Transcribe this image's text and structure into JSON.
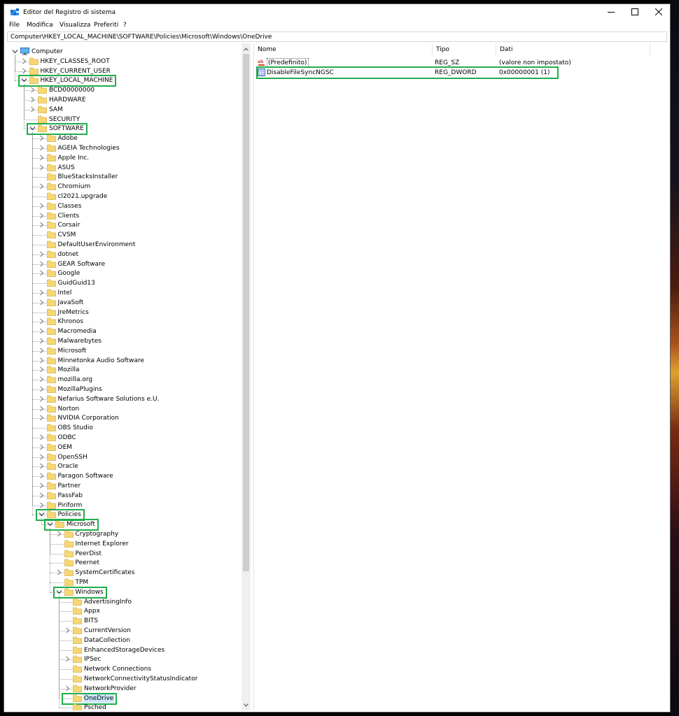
{
  "window": {
    "title": "Editor del Registro di sistema",
    "controls": [
      "minimize",
      "maximize",
      "close"
    ]
  },
  "menu": [
    "File",
    "Modifica",
    "Visualizza",
    "Preferiti",
    "?"
  ],
  "address": "Computer\\HKEY_LOCAL_MACHINE\\SOFTWARE\\Policies\\Microsoft\\Windows\\OneDrive",
  "tree": [
    {
      "label": "Computer",
      "depth": 0,
      "exp": "open",
      "icon": "computer"
    },
    {
      "label": "HKEY_CLASSES_ROOT",
      "depth": 1,
      "exp": "closed"
    },
    {
      "label": "HKEY_CURRENT_USER",
      "depth": 1,
      "exp": "closed"
    },
    {
      "label": "HKEY_LOCAL_MACHINE",
      "depth": 1,
      "exp": "open",
      "highlight": true
    },
    {
      "label": "BCD00000000",
      "depth": 2,
      "exp": "closed"
    },
    {
      "label": "HARDWARE",
      "depth": 2,
      "exp": "closed"
    },
    {
      "label": "SAM",
      "depth": 2,
      "exp": "closed"
    },
    {
      "label": "SECURITY",
      "depth": 2,
      "exp": "none"
    },
    {
      "label": "SOFTWARE",
      "depth": 2,
      "exp": "open",
      "highlight": true
    },
    {
      "label": "Adobe",
      "depth": 3,
      "exp": "closed"
    },
    {
      "label": "AGEIA Technologies",
      "depth": 3,
      "exp": "closed"
    },
    {
      "label": "Apple Inc.",
      "depth": 3,
      "exp": "closed"
    },
    {
      "label": "ASUS",
      "depth": 3,
      "exp": "closed"
    },
    {
      "label": "BlueStacksInstaller",
      "depth": 3,
      "exp": "none"
    },
    {
      "label": "Chromium",
      "depth": 3,
      "exp": "closed"
    },
    {
      "label": "cl2021.upgrade",
      "depth": 3,
      "exp": "none"
    },
    {
      "label": "Classes",
      "depth": 3,
      "exp": "closed"
    },
    {
      "label": "Clients",
      "depth": 3,
      "exp": "closed"
    },
    {
      "label": "Corsair",
      "depth": 3,
      "exp": "closed"
    },
    {
      "label": "CVSM",
      "depth": 3,
      "exp": "none"
    },
    {
      "label": "DefaultUserEnvironment",
      "depth": 3,
      "exp": "none"
    },
    {
      "label": "dotnet",
      "depth": 3,
      "exp": "closed"
    },
    {
      "label": "GEAR Software",
      "depth": 3,
      "exp": "closed"
    },
    {
      "label": "Google",
      "depth": 3,
      "exp": "closed"
    },
    {
      "label": "GuidGuid13",
      "depth": 3,
      "exp": "none"
    },
    {
      "label": "Intel",
      "depth": 3,
      "exp": "closed"
    },
    {
      "label": "JavaSoft",
      "depth": 3,
      "exp": "closed"
    },
    {
      "label": "JreMetrics",
      "depth": 3,
      "exp": "none"
    },
    {
      "label": "Khronos",
      "depth": 3,
      "exp": "closed"
    },
    {
      "label": "Macromedia",
      "depth": 3,
      "exp": "closed"
    },
    {
      "label": "Malwarebytes",
      "depth": 3,
      "exp": "closed"
    },
    {
      "label": "Microsoft",
      "depth": 3,
      "exp": "closed"
    },
    {
      "label": "Minnetonka Audio Software",
      "depth": 3,
      "exp": "closed"
    },
    {
      "label": "Mozilla",
      "depth": 3,
      "exp": "closed"
    },
    {
      "label": "mozilla.org",
      "depth": 3,
      "exp": "closed"
    },
    {
      "label": "MozillaPlugins",
      "depth": 3,
      "exp": "closed"
    },
    {
      "label": "Nefarius Software Solutions e.U.",
      "depth": 3,
      "exp": "closed"
    },
    {
      "label": "Norton",
      "depth": 3,
      "exp": "closed"
    },
    {
      "label": "NVIDIA Corporation",
      "depth": 3,
      "exp": "closed"
    },
    {
      "label": "OBS Studio",
      "depth": 3,
      "exp": "none"
    },
    {
      "label": "ODBC",
      "depth": 3,
      "exp": "closed"
    },
    {
      "label": "OEM",
      "depth": 3,
      "exp": "closed"
    },
    {
      "label": "OpenSSH",
      "depth": 3,
      "exp": "closed"
    },
    {
      "label": "Oracle",
      "depth": 3,
      "exp": "closed"
    },
    {
      "label": "Paragon Software",
      "depth": 3,
      "exp": "closed"
    },
    {
      "label": "Partner",
      "depth": 3,
      "exp": "closed"
    },
    {
      "label": "PassFab",
      "depth": 3,
      "exp": "closed"
    },
    {
      "label": "Piriform",
      "depth": 3,
      "exp": "closed"
    },
    {
      "label": "Policies",
      "depth": 3,
      "exp": "open",
      "highlight": true
    },
    {
      "label": "Microsoft",
      "depth": 4,
      "exp": "open",
      "highlight": true
    },
    {
      "label": "Cryptography",
      "depth": 5,
      "exp": "closed"
    },
    {
      "label": "Internet Explorer",
      "depth": 5,
      "exp": "none"
    },
    {
      "label": "PeerDist",
      "depth": 5,
      "exp": "none"
    },
    {
      "label": "Peernet",
      "depth": 5,
      "exp": "none"
    },
    {
      "label": "SystemCertificates",
      "depth": 5,
      "exp": "closed"
    },
    {
      "label": "TPM",
      "depth": 5,
      "exp": "none"
    },
    {
      "label": "Windows",
      "depth": 5,
      "exp": "open",
      "highlight": true
    },
    {
      "label": "AdvertisingInfo",
      "depth": 6,
      "exp": "none"
    },
    {
      "label": "Appx",
      "depth": 6,
      "exp": "none"
    },
    {
      "label": "BITS",
      "depth": 6,
      "exp": "none"
    },
    {
      "label": "CurrentVersion",
      "depth": 6,
      "exp": "closed"
    },
    {
      "label": "DataCollection",
      "depth": 6,
      "exp": "none"
    },
    {
      "label": "EnhancedStorageDevices",
      "depth": 6,
      "exp": "none"
    },
    {
      "label": "IPSec",
      "depth": 6,
      "exp": "closed"
    },
    {
      "label": "Network Connections",
      "depth": 6,
      "exp": "none"
    },
    {
      "label": "NetworkConnectivityStatusIndicator",
      "depth": 6,
      "exp": "none"
    },
    {
      "label": "NetworkProvider",
      "depth": 6,
      "exp": "closed"
    },
    {
      "label": "OneDrive",
      "depth": 6,
      "exp": "none",
      "highlight": true,
      "selected": true
    },
    {
      "label": "Psched",
      "depth": 6,
      "exp": "none"
    }
  ],
  "list": {
    "columns": [
      "Nome",
      "Tipo",
      "Dati"
    ],
    "rows": [
      {
        "name": "(Predefinito)",
        "type": "REG_SZ",
        "data": "(valore non impostato)",
        "icon": "string-value-icon"
      },
      {
        "name": "DisableFileSyncNGSC",
        "type": "REG_DWORD",
        "data": "0x00000001 (1)",
        "icon": "dword-value-icon",
        "highlight": true
      }
    ]
  },
  "colors": {
    "highlight": "#1fae4b",
    "folder": "#f7d774",
    "selection": "#cce8ff"
  }
}
